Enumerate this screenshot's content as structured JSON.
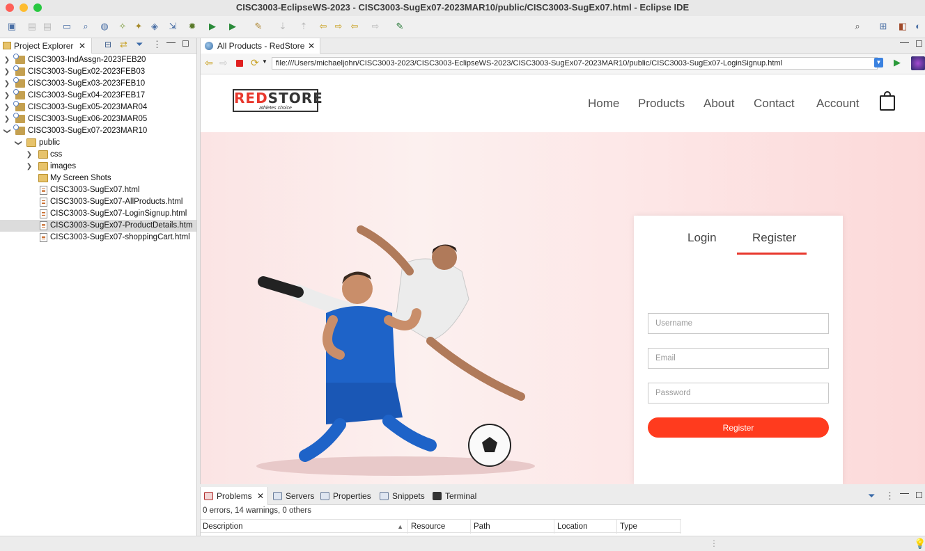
{
  "window": {
    "title": "CISC3003-EclipseWS-2023 - CISC3003-SugEx07-2023MAR10/public/CISC3003-SugEx07.html - Eclipse IDE"
  },
  "explorer": {
    "tab_label": "Project Explorer",
    "projects": [
      "CISC3003-IndAssgn-2023FEB20",
      "CISC3003-SugEx02-2023FEB03",
      "CISC3003-SugEx03-2023FEB10",
      "CISC3003-SugEx04-2023FEB17",
      "CISC3003-SugEx05-2023MAR04",
      "CISC3003-SugEx06-2023MAR05",
      "CISC3003-SugEx07-2023MAR10"
    ],
    "public_folder": "public",
    "folders": [
      "css",
      "images",
      "My Screen Shots"
    ],
    "files": [
      "CISC3003-SugEx07.html",
      "CISC3003-SugEx07-AllProducts.html",
      "CISC3003-SugEx07-LoginSignup.html",
      "CISC3003-SugEx07-ProductDetails.htm",
      "CISC3003-SugEx07-shoppingCart.html"
    ]
  },
  "editor": {
    "tab_label": "All Products - RedStore",
    "url": "file:///Users/michaeljohn/CISC3003-2023/CISC3003-EclipseWS-2023/CISC3003-SugEx07-2023MAR10/public/CISC3003-SugEx07-LoginSignup.html"
  },
  "site": {
    "logo_main_red": "RED",
    "logo_main_rest": "STORE",
    "logo_sub": "athletes choice",
    "nav": [
      "Home",
      "Products",
      "About",
      "Contact",
      "Account"
    ],
    "form": {
      "login_tab": "Login",
      "register_tab": "Register",
      "username_placeholder": "Username",
      "email_placeholder": "Email",
      "password_placeholder": "Password",
      "register_button": "Register"
    }
  },
  "bottom": {
    "tabs": [
      "Problems",
      "Servers",
      "Properties",
      "Snippets",
      "Terminal"
    ],
    "summary": "0 errors, 14 warnings, 0 others",
    "columns": [
      "Description",
      "Resource",
      "Path",
      "Location",
      "Type"
    ]
  },
  "colors": {
    "accent": "#e8382d",
    "button": "#ff3b1e"
  }
}
